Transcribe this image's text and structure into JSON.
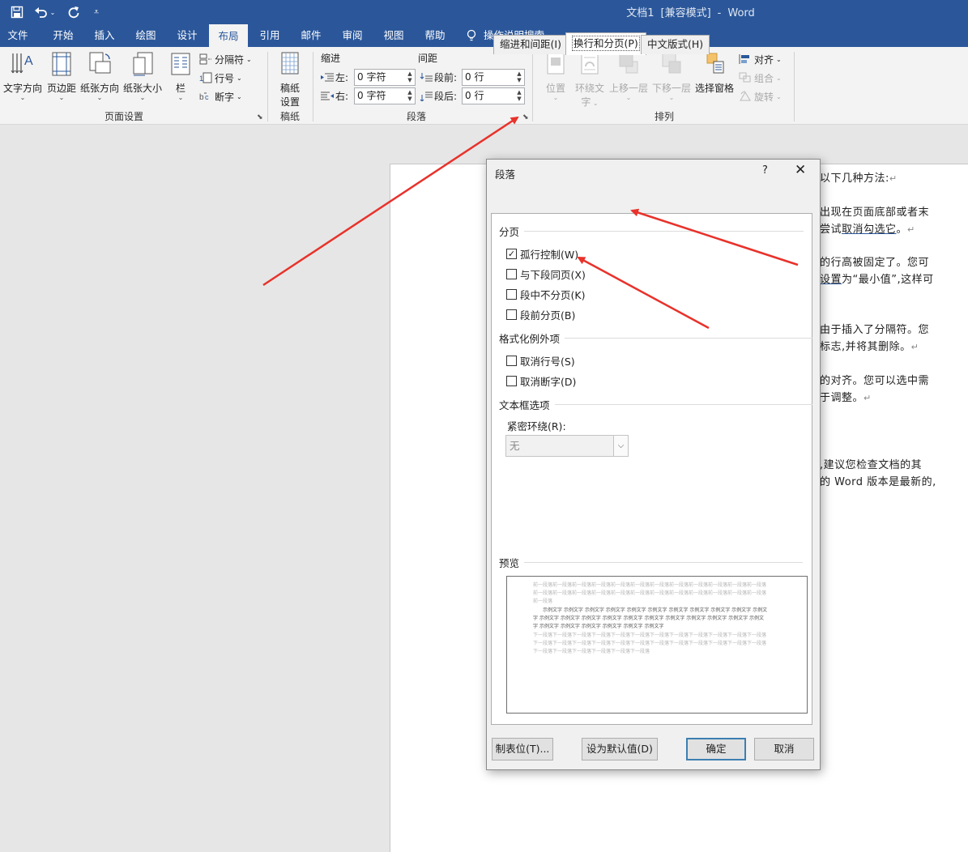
{
  "window": {
    "doc_name": "文档1",
    "mode": "[兼容模式]",
    "separator": "-",
    "app_name": "Word"
  },
  "quick_access": {
    "save_icon": "save-icon",
    "undo_icon": "undo-icon",
    "redo_icon": "redo-icon",
    "customize_icon": "customize-icon"
  },
  "tabs": [
    "文件",
    "开始",
    "插入",
    "绘图",
    "设计",
    "布局",
    "引用",
    "邮件",
    "审阅",
    "视图",
    "帮助"
  ],
  "active_tab": "布局",
  "tell_me": "操作说明搜索",
  "ribbon": {
    "page_setup": {
      "text_direction": "文字方向",
      "margins": "页边距",
      "orientation": "纸张方向",
      "size": "纸张大小",
      "columns": "栏",
      "breaks": "分隔符",
      "line_numbers": "行号",
      "hyphenation": "断字",
      "label": "页面设置"
    },
    "manuscript": {
      "button": "稿纸\n设置",
      "button_line1": "稿纸",
      "button_line2": "设置",
      "label": "稿纸"
    },
    "paragraph": {
      "indent_header": "缩进",
      "spacing_header": "间距",
      "left_label": "左:",
      "right_label": "右:",
      "before_label": "段前:",
      "after_label": "段后:",
      "left_value": "0 字符",
      "right_value": "0 字符",
      "before_value": "0 行",
      "after_value": "0 行",
      "label": "段落"
    },
    "arrange": {
      "position": "位置",
      "wrap_text_1": "环绕文",
      "wrap_text_2": "字",
      "bring_forward": "上移一层",
      "send_backward": "下移一层",
      "selection_pane": "选择窗格",
      "align": "对齐",
      "group": "组合",
      "rotate": "旋转",
      "label": "排列"
    }
  },
  "document": {
    "lines": [
      {
        "text": "以下几种方法:",
        "ret": "↵"
      },
      {
        "text": "出现在页面底部或者末",
        "ret": ""
      },
      {
        "pre": "尝试",
        "link": "取消勾选它",
        "text": "。",
        "ret": "↵"
      },
      {
        "text": "的行高被固定了。您可",
        "ret": ""
      },
      {
        "link": "设置",
        "text": "为“最小值”,这样可",
        "ret": ""
      },
      {
        "text": "由于插入了分隔符。您",
        "ret": ""
      },
      {
        "text": "标志,并将其删除。",
        "ret": "↵"
      },
      {
        "text": "的对齐。您可以选中需",
        "ret": ""
      },
      {
        "text": "于调整。",
        "ret": "↵"
      },
      {
        "text": ",建议您检查文档的其",
        "ret": ""
      },
      {
        "text": "的 Word 版本是最新的,",
        "ret": ""
      }
    ]
  },
  "dialog": {
    "title": "段落",
    "help": "?",
    "close": "✕",
    "tabs": [
      "缩进和间距(I)",
      "换行和分页(P)",
      "中文版式(H)"
    ],
    "active_tab": "换行和分页(P)",
    "pagination": {
      "header": "分页",
      "options": [
        {
          "label": "孤行控制(W)",
          "checked": true
        },
        {
          "label": "与下段同页(X)",
          "checked": false
        },
        {
          "label": "段中不分页(K)",
          "checked": false
        },
        {
          "label": "段前分页(B)",
          "checked": false
        }
      ]
    },
    "formatting_exceptions": {
      "header": "格式化例外项",
      "options": [
        {
          "label": "取消行号(S)",
          "checked": false
        },
        {
          "label": "取消断字(D)",
          "checked": false
        }
      ]
    },
    "textbox_options": {
      "header": "文本框选项",
      "tight_wrap_label": "紧密环绕(R):",
      "tight_wrap_value": "无"
    },
    "preview": {
      "header": "预览",
      "prev_paragraph": "前一段落前一段落前一段落前一段落前一段落前一段落前一段落前一段落前一段落前一段落前一段落前一段落前一段落前一段落前一段落前一段落前一段落前一段落前一段落前一段落前一段落前一段落前一段落前一段落前一段落",
      "sample_text": "示例文字 示例文字 示例文字 示例文字 示例文字 示例文字 示例文字 示例文字 示例文字 示例文字 示例文字 示例文字 示例文字 示例文字 示例文字 示例文字 示例文字 示例文字 示例文字 示例文字 示例文字 示例文字 示例文字 示例文字 示例文字 示例文字 示例文字 示例文字",
      "next_paragraph": "下一段落下一段落下一段落下一段落下一段落下一段落下一段落下一段落下一段落下一段落下一段落下一段落下一段落下一段落下一段落下一段落下一段落下一段落下一段落下一段落下一段落下一段落下一段落下一段落下一段落下一段落下一段落下一段落下一段落下一段落"
    },
    "buttons": {
      "tabs": "制表位(T)...",
      "set_default": "设为默认值(D)",
      "ok": "确定",
      "cancel": "取消"
    }
  },
  "colors": {
    "title_bar": "#2b579a",
    "ribbon_bg": "#f3f3f3",
    "annotation_arrow": "#e8322b",
    "dialog_bg": "#f0f0f0"
  }
}
